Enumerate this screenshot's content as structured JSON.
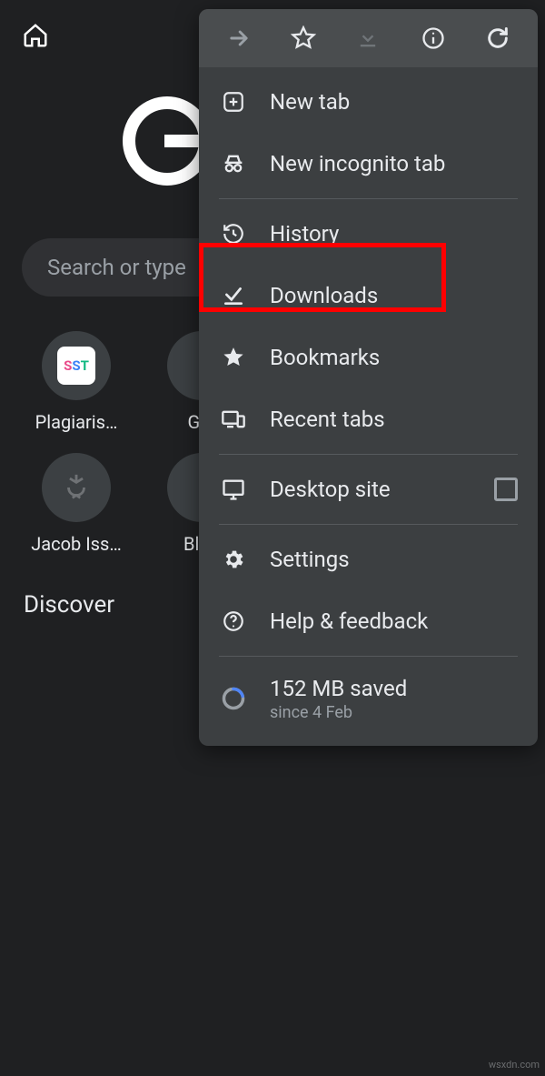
{
  "sst_text": "SST",
  "toolbar": {
    "icons": {
      "home": "home-icon",
      "forward": "forward-icon",
      "star": "star-outline-icon",
      "download": "download-icon",
      "info": "info-icon",
      "reload": "reload-icon"
    }
  },
  "search": {
    "placeholder": "Search or type "
  },
  "shortcuts": [
    {
      "label": "Plagiaris…"
    },
    {
      "label": "Gra"
    },
    {
      "label": "Jacob Iss…"
    },
    {
      "label": "Blog"
    }
  ],
  "discover": "Discover",
  "menu": {
    "items": {
      "new_tab": "New tab",
      "incognito": "New incognito tab",
      "history": "History",
      "downloads": "Downloads",
      "bookmarks": "Bookmarks",
      "recent_tabs": "Recent tabs",
      "desktop_site": "Desktop site",
      "settings": "Settings",
      "help": "Help & feedback",
      "data_main": "152 MB saved",
      "data_sub": "since 4 Feb"
    }
  },
  "watermark": "wsxdn.com"
}
